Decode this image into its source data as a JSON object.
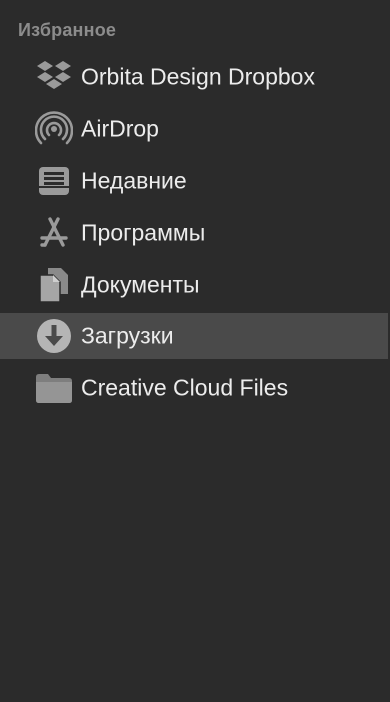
{
  "sidebar": {
    "section_title": "Избранное",
    "items": [
      {
        "label": "Orbita Design Dropbox",
        "icon": "dropbox-icon"
      },
      {
        "label": "AirDrop",
        "icon": "airdrop-icon"
      },
      {
        "label": "Недавние",
        "icon": "recents-icon"
      },
      {
        "label": "Программы",
        "icon": "applications-icon"
      },
      {
        "label": "Документы",
        "icon": "documents-icon"
      },
      {
        "label": "Загрузки",
        "icon": "downloads-icon",
        "selected": true
      },
      {
        "label": "Creative Cloud Files",
        "icon": "folder-icon"
      }
    ]
  },
  "colors": {
    "background": "#2b2b2b",
    "selected_row": "#4a4a4a",
    "icon": "#9a9a9a",
    "text": "#ececec",
    "section_title": "#8c8c8c"
  }
}
